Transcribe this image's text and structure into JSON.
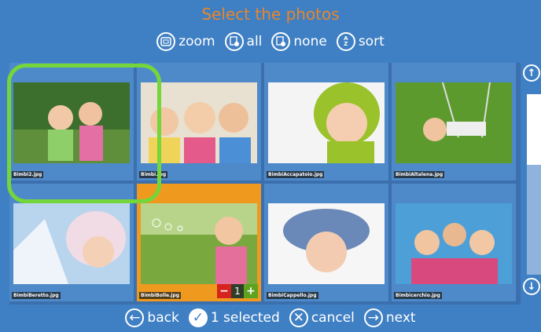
{
  "title": "Select the photos",
  "toolbar": {
    "zoom": "zoom",
    "all": "all",
    "none": "none",
    "sort": "sort"
  },
  "photos": [
    {
      "name": "Bimbi2.jpg",
      "selected": false
    },
    {
      "name": "Bimbi.jpg",
      "selected": false
    },
    {
      "name": "BimbiAccapatoio.jpg",
      "selected": false
    },
    {
      "name": "BimbiAltalena.jpg",
      "selected": false
    },
    {
      "name": "BimbiBeretto.jpg",
      "selected": false
    },
    {
      "name": "BimbiBolle.jpg",
      "selected": true,
      "count": "1"
    },
    {
      "name": "BimbiCappello.jpg",
      "selected": false
    },
    {
      "name": "Bimbicerchio.jpg",
      "selected": false
    }
  ],
  "stepper": {
    "minus": "−",
    "count": "1",
    "plus": "+"
  },
  "bottom": {
    "back": "back",
    "selected": "1 selected",
    "cancel": "cancel",
    "next": "next"
  },
  "colors": {
    "background": "#3f7fc3",
    "title": "#e9872a",
    "selected_tile": "#ef9a1e",
    "focus_ring": "#74d63a"
  }
}
